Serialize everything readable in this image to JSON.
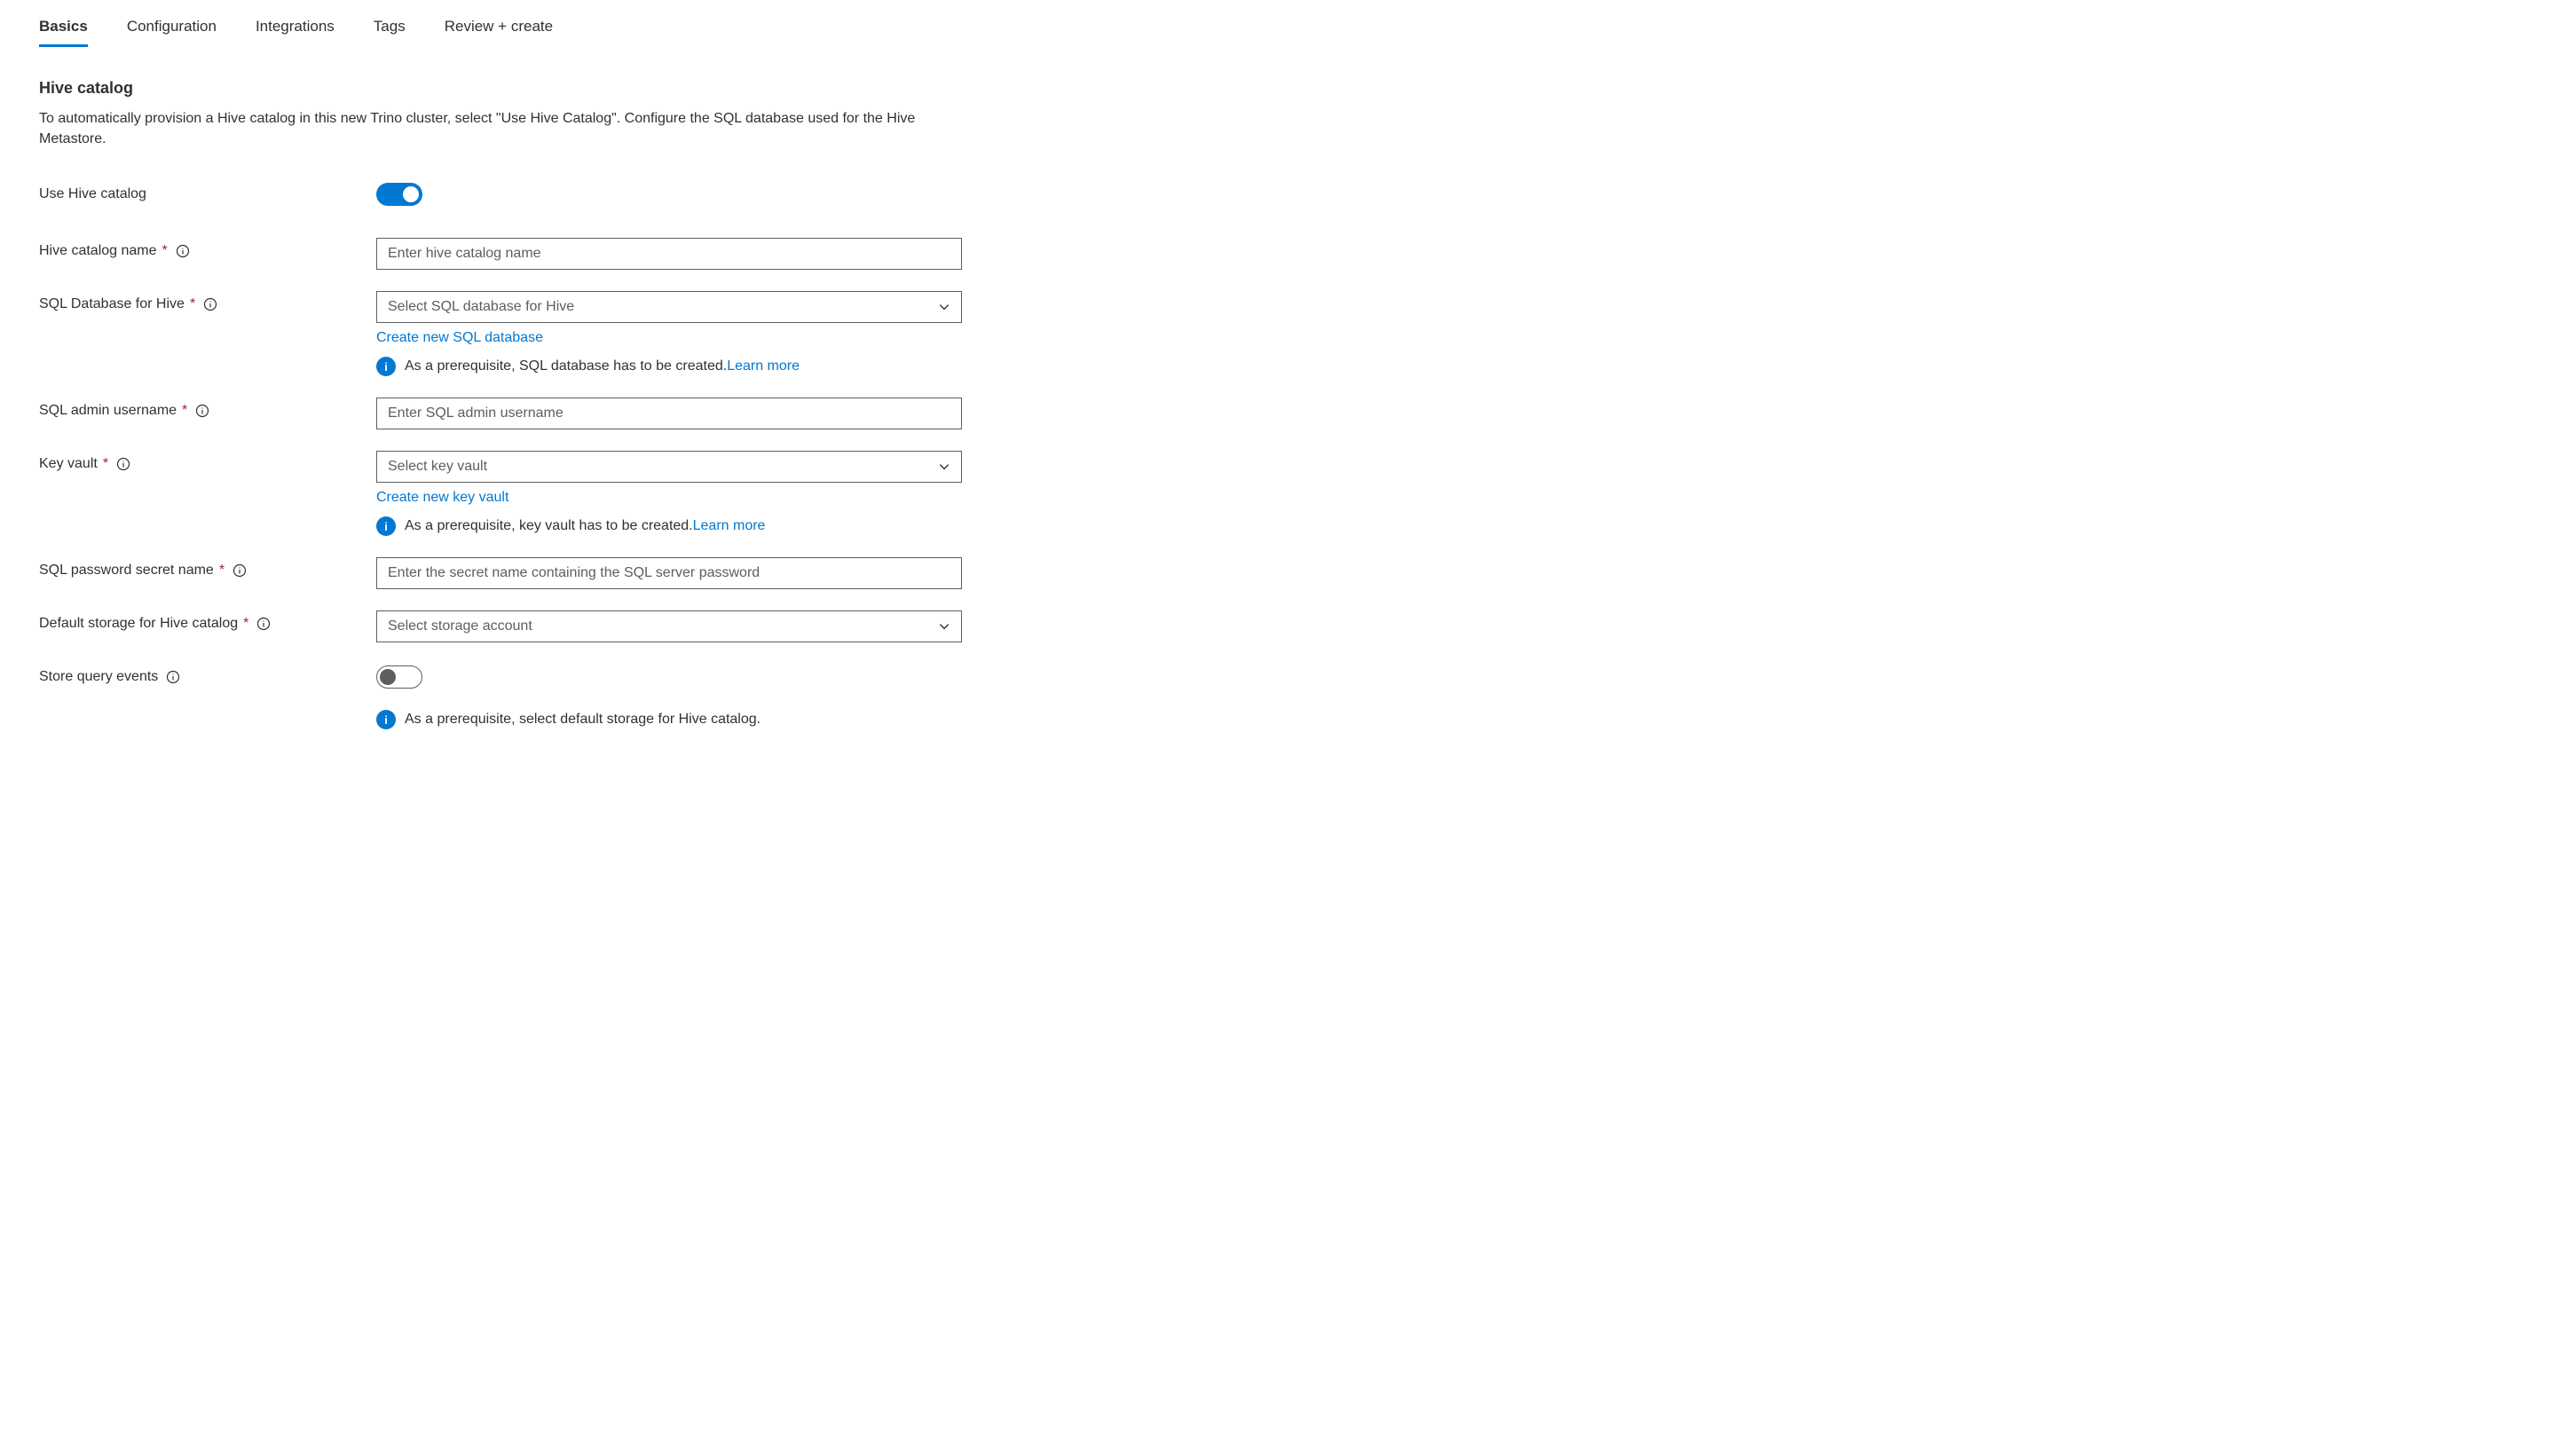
{
  "tabs": [
    {
      "label": "Basics",
      "active": true
    },
    {
      "label": "Configuration",
      "active": false
    },
    {
      "label": "Integrations",
      "active": false
    },
    {
      "label": "Tags",
      "active": false
    },
    {
      "label": "Review + create",
      "active": false
    }
  ],
  "section": {
    "title": "Hive catalog",
    "description": "To automatically provision a Hive catalog in this new Trino cluster, select \"Use Hive Catalog\". Configure the SQL database used for the Hive Metastore."
  },
  "fields": {
    "use_hive_catalog": {
      "label": "Use Hive catalog",
      "value": true
    },
    "hive_catalog_name": {
      "label": "Hive catalog name",
      "placeholder": "Enter hive catalog name",
      "required": true
    },
    "sql_database": {
      "label": "SQL Database for Hive",
      "placeholder": "Select SQL database for Hive",
      "required": true,
      "create_link": "Create new SQL database",
      "info_text": "As a prerequisite, SQL database has to be created.",
      "learn_more": "Learn more"
    },
    "sql_admin_username": {
      "label": "SQL admin username",
      "placeholder": "Enter SQL admin username",
      "required": true
    },
    "key_vault": {
      "label": "Key vault",
      "placeholder": "Select key vault",
      "required": true,
      "create_link": "Create new key vault",
      "info_text": "As a prerequisite, key vault has to be created.",
      "learn_more": "Learn more"
    },
    "sql_password_secret": {
      "label": "SQL password secret name",
      "placeholder": "Enter the secret name containing the SQL server password",
      "required": true
    },
    "default_storage": {
      "label": "Default storage for Hive catalog",
      "placeholder": "Select storage account",
      "required": true
    },
    "store_query_events": {
      "label": "Store query events",
      "value": false,
      "info_text": "As a prerequisite, select default storage for Hive catalog."
    }
  }
}
